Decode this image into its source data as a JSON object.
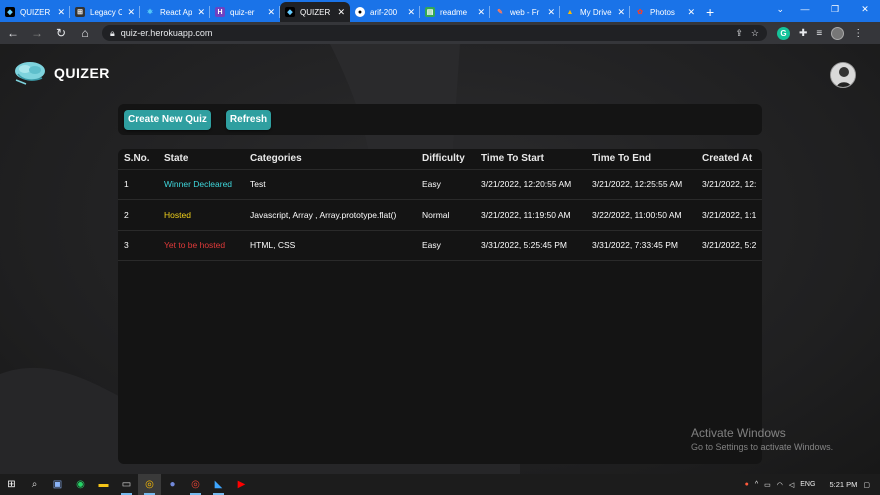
{
  "browser": {
    "tabs": [
      {
        "title": "QUIZER",
        "favicon": "quizer-favicon",
        "color": "#202124",
        "active": false
      },
      {
        "title": "Legacy Code",
        "favicon": "legacy-favicon",
        "color": "#111",
        "active": false
      },
      {
        "title": "React App",
        "favicon": "react-favicon",
        "color": "#1a73e8",
        "active": false
      },
      {
        "title": "quiz-er",
        "favicon": "heroku-favicon",
        "color": "#6f42c1",
        "active": false
      },
      {
        "title": "QUIZER",
        "favicon": "quizer-favicon",
        "color": "#202124",
        "active": true
      },
      {
        "title": "arif-200",
        "favicon": "github-favicon",
        "color": "#fff",
        "active": false
      },
      {
        "title": "readme",
        "favicon": "docs-favicon",
        "color": "#34a853",
        "active": false
      },
      {
        "title": "web - Fr",
        "favicon": "web-favicon",
        "color": "#ea4335",
        "active": false
      },
      {
        "title": "My Drive",
        "favicon": "drive-favicon",
        "color": "#fbbc04",
        "active": false
      },
      {
        "title": "Photos",
        "favicon": "photos-favicon",
        "color": "#ea4335",
        "active": false
      }
    ],
    "new_tab_label": "+",
    "url": "quiz-er.herokuapp.com"
  },
  "app": {
    "logo_text": "QUIZER",
    "buttons": {
      "create": "Create New Quiz",
      "refresh": "Refresh"
    },
    "table": {
      "headers": [
        "S.No.",
        "State",
        "Categories",
        "Difficulty",
        "Time To Start",
        "Time To End",
        "Created At"
      ],
      "rows": [
        {
          "sno": "1",
          "state": "Winner Decleared",
          "state_color": "#3fd8dd",
          "categories": "Test",
          "difficulty": "Easy",
          "start": "3/21/2022, 12:20:55 AM",
          "end": "3/21/2022, 12:25:55 AM",
          "created": "3/21/2022, 12:"
        },
        {
          "sno": "2",
          "state": "Hosted",
          "state_color": "#f2d21b",
          "categories": "Javascript, Array , Array.prototype.flat()",
          "difficulty": "Normal",
          "start": "3/21/2022, 11:19:50 AM",
          "end": "3/22/2022, 11:00:50 AM",
          "created": "3/21/2022, 1:1"
        },
        {
          "sno": "3",
          "state": "Yet to be hosted",
          "state_color": "#e03a3a",
          "categories": "HTML, CSS",
          "difficulty": "Easy",
          "start": "3/31/2022, 5:25:45 PM",
          "end": "3/31/2022, 7:33:45 PM",
          "created": "3/21/2022, 5:2"
        }
      ]
    }
  },
  "watermark": {
    "line1": "Activate Windows",
    "line2": "Go to Settings to activate Windows."
  },
  "taskbar": {
    "lang": "ENG",
    "time": "5:21 PM"
  },
  "colors": {
    "accent": "#2f9fa0",
    "tabstrip": "#1a73e8"
  }
}
